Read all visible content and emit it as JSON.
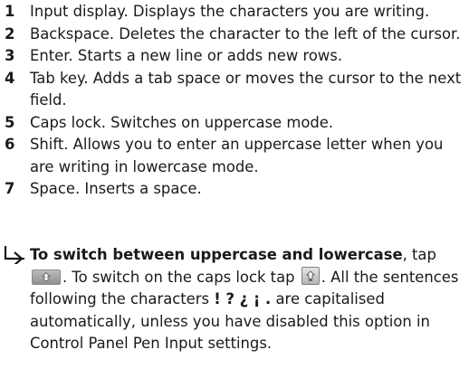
{
  "items": [
    {
      "number": "1",
      "text": "Input display. Displays the characters you are writing."
    },
    {
      "number": "2",
      "text": "Backspace. Deletes the character to the left of the cursor."
    },
    {
      "number": "3",
      "text": "Enter. Starts a new line or adds new rows."
    },
    {
      "number": "4",
      "text": "Tab key. Adds a tab space or moves the cursor to the next field."
    },
    {
      "number": "5",
      "text": "Caps lock. Switches on uppercase mode."
    },
    {
      "number": "6",
      "text": "Shift. Allows you to enter an uppercase letter when you are writing in lowercase mode."
    },
    {
      "number": "7",
      "text": "Space. Inserts a space."
    }
  ],
  "tip": {
    "heading": "To switch between uppercase and lowercase",
    "text_1": ", tap",
    "shift_icon": "shift-key-icon",
    "text_2": ". To switch on the caps lock tap",
    "caps_icon": "caps-lock-key-icon",
    "text_3": ". All the sentences following the characters",
    "characters": "! ? ¿ ¡ .",
    "text_4": "are capitalised automatically, unless you have disabled this option in Control Panel Pen Input settings."
  }
}
